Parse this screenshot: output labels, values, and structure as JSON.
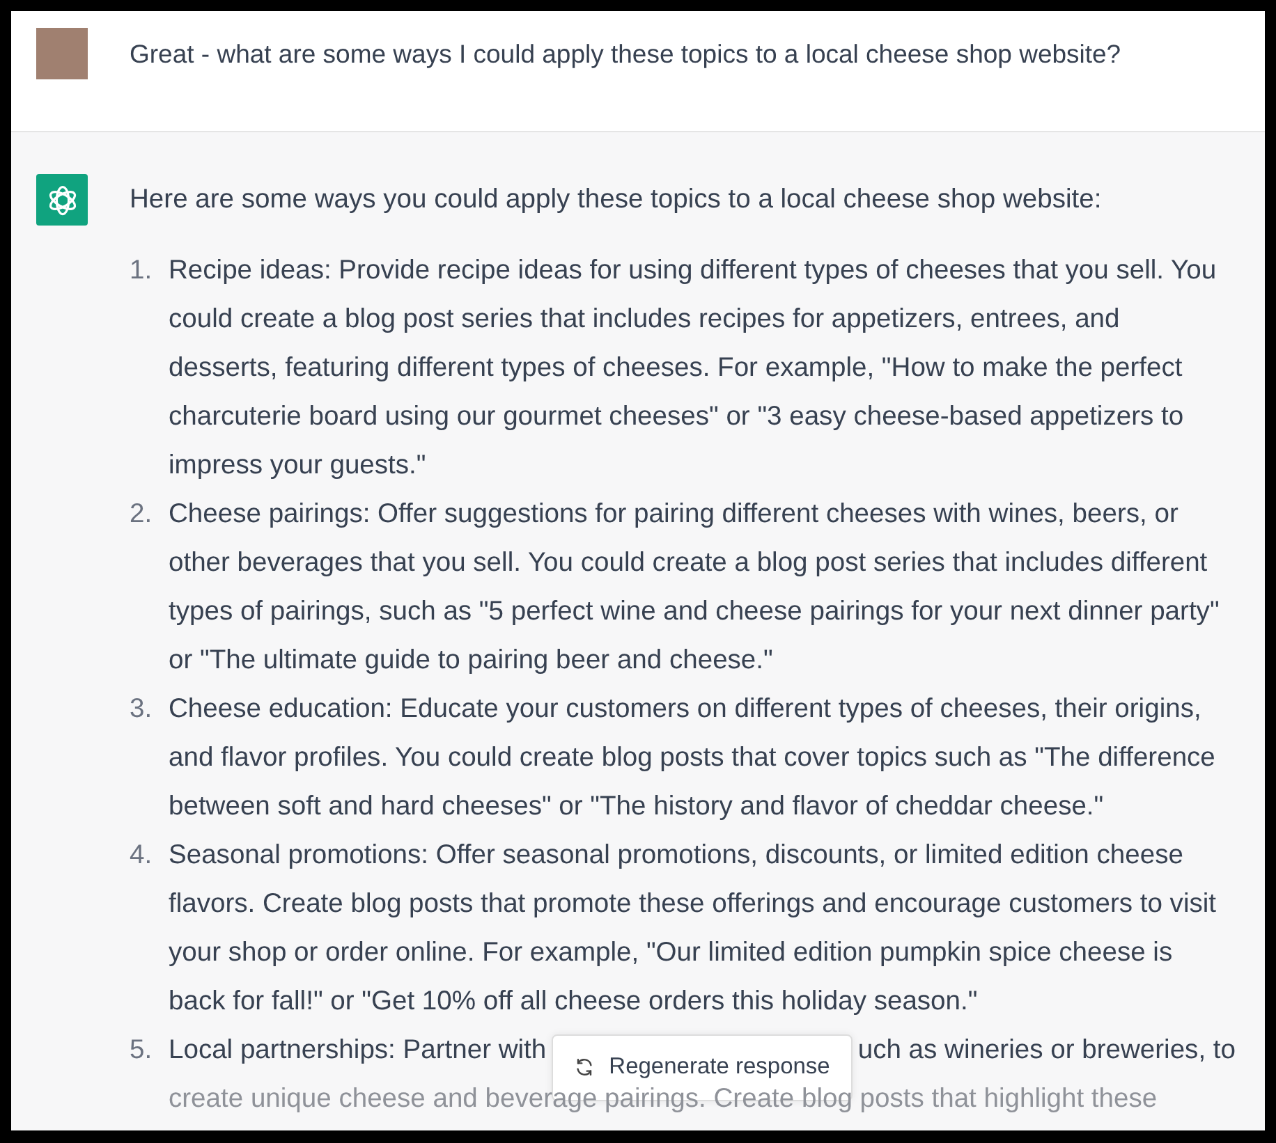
{
  "user_message": {
    "text": "Great - what are some ways I could apply these topics to a local cheese shop website?"
  },
  "assistant_message": {
    "intro": "Here are some ways you could apply these topics to a local cheese shop website:",
    "items": [
      {
        "kind": "text",
        "number": "1.",
        "text": "Recipe ideas: Provide recipe ideas for using different types of cheeses that you sell. You could create a blog post series that includes recipes for appetizers, entrees, and desserts, featuring different types of cheeses. For example, \"How to make the perfect charcuterie board using our gourmet cheeses\" or \"3 easy cheese-based appetizers to impress your guests.\""
      },
      {
        "kind": "text",
        "number": "2.",
        "text": "Cheese pairings: Offer suggestions for pairing different cheeses with wines, beers, or other beverages that you sell. You could create a blog post series that includes different types of pairings, such as \"5 perfect wine and cheese pairings for your next dinner party\" or \"The ultimate guide to pairing beer and cheese.\""
      },
      {
        "kind": "text",
        "number": "3.",
        "text": "Cheese education: Educate your customers on different types of cheeses, their origins, and flavor profiles. You could create blog posts that cover topics such as \"The difference between soft and hard cheeses\" or \"The history and flavor of cheddar cheese.\""
      },
      {
        "kind": "text",
        "number": "4.",
        "text": "Seasonal promotions: Offer seasonal promotions, discounts, or limited edition cheese flavors. Create blog posts that promote these offerings and encourage customers to visit your shop or order online. For example, \"Our limited edition pumpkin spice cheese is back for fall!\" or \"Get 10% off all cheese orders this holiday season.\""
      },
      {
        "kind": "covered",
        "number": "5.",
        "before": "Local partnerships: Partner with",
        "after": "uch as wineries or breweries, to",
        "faded": "create unique cheese and beverage pairings. Create blog posts that highlight these"
      }
    ]
  },
  "regenerate_button": {
    "label": "Regenerate response"
  }
}
